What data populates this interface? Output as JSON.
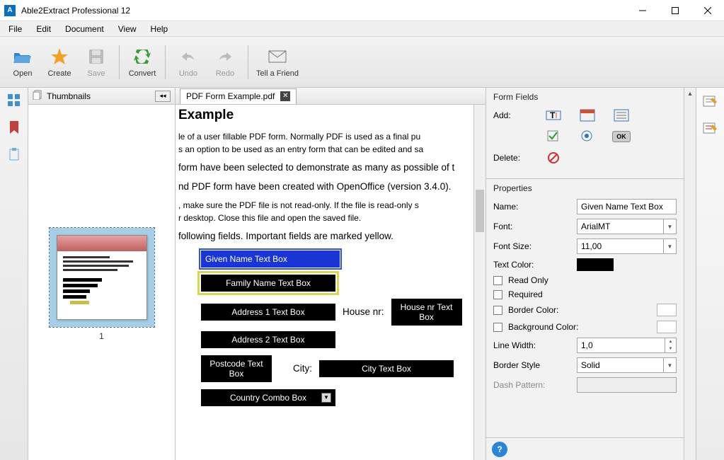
{
  "app": {
    "title": "Able2Extract Professional 12"
  },
  "menu": {
    "file": "File",
    "edit": "Edit",
    "document": "Document",
    "view": "View",
    "help": "Help"
  },
  "toolbar": {
    "open": "Open",
    "create": "Create",
    "save": "Save",
    "convert": "Convert",
    "undo": "Undo",
    "redo": "Redo",
    "tellfriend": "Tell a Friend"
  },
  "panels": {
    "thumbnails": "Thumbnails"
  },
  "thumb": {
    "page1": "1"
  },
  "tab": {
    "name": "PDF Form Example.pdf"
  },
  "doc": {
    "heading": "Example",
    "p1a": "le of a user fillable PDF form. Normally PDF is used as a final pu",
    "p1b": "s an option to be used as an entry form that can be edited and sa",
    "p2": "form have been selected to demonstrate as many as possible of t",
    "p3": "nd PDF form have been created with OpenOffice (version 3.4.0).",
    "p4a": ", make sure the PDF file is not read-only. If the file is read-only s",
    "p4b": "r desktop. Close this file and open the saved file.",
    "p5": " following fields. Important fields are marked yellow.",
    "lbl_house": "House nr:",
    "lbl_city": "City:",
    "f_given": "Given Name Text Box",
    "f_family": "Family Name Text Box",
    "f_addr1": "Address 1 Text Box",
    "f_addr2": "Address 2 Text Box",
    "f_house": "House nr Text Box",
    "f_postcode": "Postcode Text Box",
    "f_city": "City Text Box",
    "f_country": "Country Combo Box"
  },
  "props": {
    "group_formfields": "Form Fields",
    "add_label": "Add:",
    "delete_label": "Delete:",
    "ok": "OK",
    "group_properties": "Properties",
    "name_label": "Name:",
    "name_value": "Given Name Text Box",
    "font_label": "Font:",
    "font_value": "ArialMT",
    "fontsize_label": "Font Size:",
    "fontsize_value": "11,00",
    "textcolor_label": "Text Color:",
    "readonly_label": "Read Only",
    "required_label": "Required",
    "bordercolor_label": "Border Color:",
    "bgcolor_label": "Background Color:",
    "linewidth_label": "Line Width:",
    "linewidth_value": "1,0",
    "borderstyle_label": "Border Style",
    "borderstyle_value": "Solid",
    "dash_label": "Dash Pattern:"
  }
}
